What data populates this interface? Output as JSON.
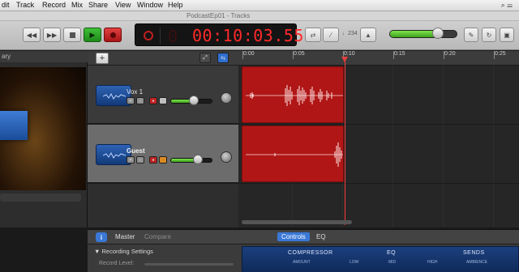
{
  "menubar": {
    "items": [
      "dit",
      "Track",
      "Record",
      "Mix",
      "Share",
      "View",
      "Window",
      "Help"
    ]
  },
  "window": {
    "title": "PodcastEp01 - Tracks"
  },
  "transport": {
    "time": "00:10:03.55",
    "count_in": "♩234",
    "rewind_icon": "rewind-icon",
    "forward_icon": "fast-forward-icon",
    "stop_icon": "stop-icon",
    "play_icon": "play-icon",
    "record_icon": "record-icon"
  },
  "master_volume": {
    "level": 0.72
  },
  "library": {
    "header": "ary"
  },
  "tracks_header": {
    "add_label": "+"
  },
  "ruler": {
    "ticks": [
      "0:00",
      "0:05",
      "0:10",
      "0:15",
      "0:20",
      "0:25"
    ]
  },
  "tracks": [
    {
      "name": "Vox 1",
      "volume": 0.55,
      "selected": false
    },
    {
      "name": "Guest",
      "volume": 0.65,
      "selected": true
    }
  ],
  "smart_controls": {
    "info": "i",
    "tab_master": "Master",
    "tab_compare": "Compare",
    "tab_controls": "Controls",
    "tab_eq": "EQ",
    "recording_settings": "▼ Recording Settings",
    "record_level": "Record Level:",
    "panel": {
      "compressor": "COMPRESSOR",
      "eq": "EQ",
      "sends": "SENDS",
      "amount": "AMOUNT",
      "low": "LOW",
      "mid": "MID",
      "high": "HIGH",
      "ambience": "AMBIENCE"
    }
  },
  "colors": {
    "region_red": "#b01616",
    "lcd_red": "#ff2a2a",
    "play_green": "#2f9e2a",
    "record_red": "#c62020",
    "accent_blue": "#3a78d6"
  }
}
